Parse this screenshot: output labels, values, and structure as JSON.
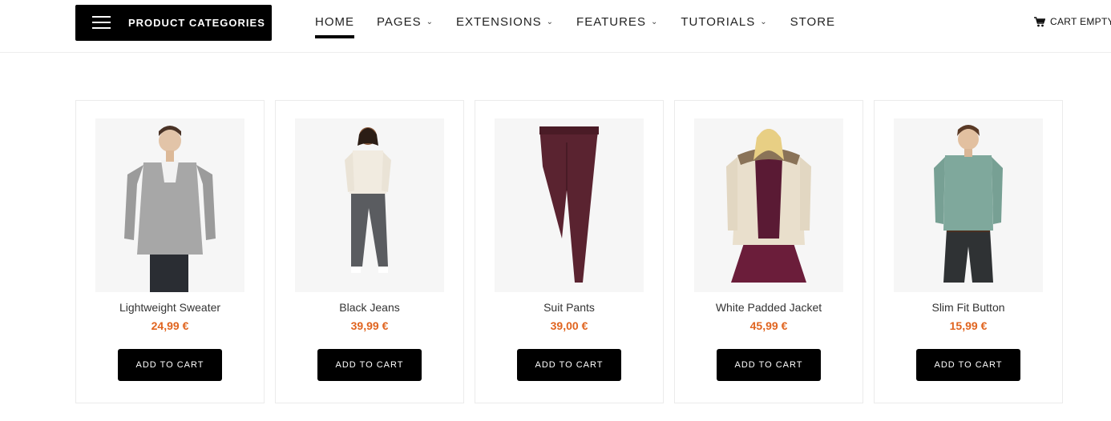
{
  "header": {
    "category_button_label": "PRODUCT CATEGORIES",
    "nav": [
      {
        "label": "HOME",
        "has_dropdown": false,
        "active": true
      },
      {
        "label": "PAGES",
        "has_dropdown": true,
        "active": false
      },
      {
        "label": "EXTENSIONS",
        "has_dropdown": true,
        "active": false
      },
      {
        "label": "FEATURES",
        "has_dropdown": true,
        "active": false
      },
      {
        "label": "TUTORIALS",
        "has_dropdown": true,
        "active": false
      },
      {
        "label": "STORE",
        "has_dropdown": false,
        "active": false
      }
    ],
    "cart_label": "CART EMPTY"
  },
  "products": [
    {
      "name": "Lightweight Sweater",
      "price": "24,99 €",
      "button": "ADD TO CART",
      "image": "man-grey-cardigan"
    },
    {
      "name": "Black Jeans",
      "price": "39,99 €",
      "button": "ADD TO CART",
      "image": "woman-grey-jeans"
    },
    {
      "name": "Suit Pants",
      "price": "39,00 €",
      "button": "ADD TO CART",
      "image": "burgundy-trousers"
    },
    {
      "name": "White Padded Jacket",
      "price": "45,99 €",
      "button": "ADD TO CART",
      "image": "woman-padded-jacket"
    },
    {
      "name": "Slim Fit Button",
      "price": "15,99 €",
      "button": "ADD TO CART",
      "image": "man-green-shirt"
    }
  ],
  "colors": {
    "accent_price": "#e0641f",
    "button_bg": "#000000",
    "page_bg": "#ffffff"
  }
}
